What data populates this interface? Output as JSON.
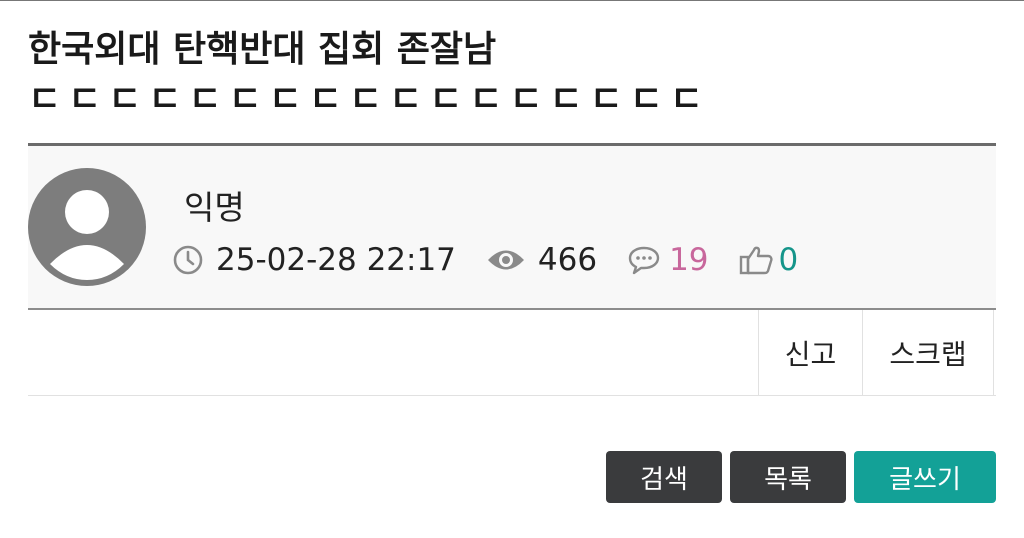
{
  "post": {
    "title": "한국외대 탄핵반대 집회 존잘남",
    "body_preview": "ㄷㄷㄷㄷㄷㄷㄷㄷㄷㄷㄷㄷㄷㄷㄷㄷㄷ"
  },
  "author": {
    "name": "익명",
    "avatar_icon": "default-avatar-icon"
  },
  "meta": {
    "datetime": "25-02-28 22:17",
    "views": "466",
    "comments": "19",
    "likes": "0",
    "icons": {
      "time": "clock-icon",
      "views": "eye-icon",
      "comments": "speech-bubble-icon",
      "likes": "thumbs-up-icon"
    },
    "colors": {
      "comments": "#c8679c",
      "likes": "#15958a"
    }
  },
  "actions": {
    "report_label": "신고",
    "scrap_label": "스크랩"
  },
  "buttons": {
    "search_label": "검색",
    "list_label": "목록",
    "write_label": "글쓰기"
  },
  "colors": {
    "dark_button": "#3a3b3d",
    "accent": "#13a197"
  }
}
